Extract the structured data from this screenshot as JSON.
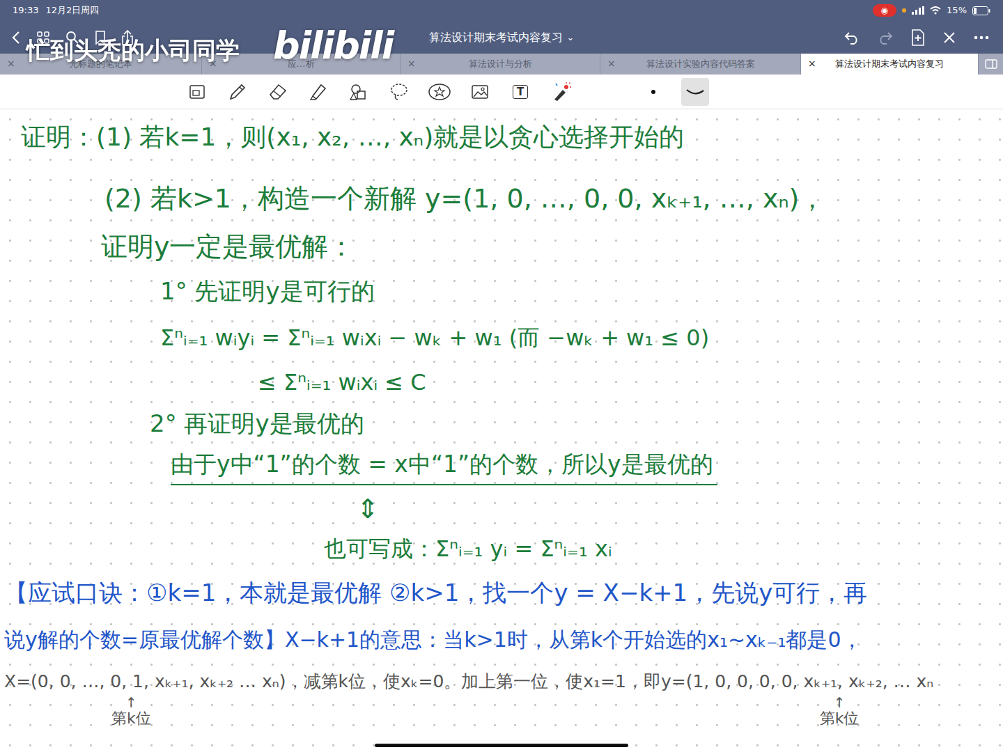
{
  "status_bar": {
    "time": "19:33",
    "date": "12月2日周四",
    "record": "◉",
    "battery": "15%"
  },
  "watermark": {
    "author": "忙到头秃的小司同学",
    "logo": "bilibili"
  },
  "toolbar": {
    "title": "算法设计期末考试内容复习",
    "dropdown": "⌄"
  },
  "tabs": [
    {
      "label": "无标题的笔记本",
      "close": "×",
      "selected": false
    },
    {
      "label": "应…析",
      "close": "×",
      "selected": false
    },
    {
      "label": "算法设计与分析",
      "close": "×",
      "selected": false
    },
    {
      "label": "算法设计实验内容代码答案",
      "close": "×",
      "selected": false
    },
    {
      "label": "算法设计期末考试内容复习",
      "close": "×",
      "selected": true
    }
  ],
  "tools": [
    {
      "selected": false
    },
    {
      "selected": false
    },
    {
      "selected": false
    },
    {
      "selected": false
    },
    {
      "selected": false
    },
    {
      "selected": false
    },
    {
      "selected": false
    },
    {
      "selected": false
    },
    {
      "selected": false,
      "label": "T"
    },
    {
      "selected": false
    },
    {
      "selected": false
    },
    {
      "selected": true
    }
  ],
  "notes": [
    {
      "text": "证明：(1) 若k=1，则(x₁, x₂, …, xₙ)就是以贪心选择开始的",
      "color": "#1b7d3a"
    },
    {
      "text": "(2) 若k>1，构造一个新解 y=(1, 0, …, 0, 0, xₖ₊₁, …, xₙ)，",
      "color": "#1b7d3a"
    },
    {
      "text": "证明y一定是最优解：",
      "color": "#1b7d3a"
    },
    {
      "text": "1° 先证明y是可行的",
      "color": "#1b7d3a"
    },
    {
      "text": "Σⁿᵢ₌₁ wᵢyᵢ = Σⁿᵢ₌₁ wᵢxᵢ − wₖ + w₁   (而 −wₖ + w₁ ≤ 0)",
      "color": "#1b7d3a"
    },
    {
      "text": "≤ Σⁿᵢ₌₁ wᵢxᵢ ≤ C",
      "color": "#1b7d3a"
    },
    {
      "text": "2° 再证明y是最优的",
      "color": "#1b7d3a"
    },
    {
      "text": "由于y中“1”的个数 = x中“1”的个数，所以y是最优的",
      "color": "#1b7d3a"
    },
    {
      "text": "⇕",
      "color": "#1b7d3a"
    },
    {
      "text": "也可写成：Σⁿᵢ₌₁ yᵢ = Σⁿᵢ₌₁ xᵢ",
      "color": "#1b7d3a"
    },
    {
      "text": "【应试口诀：①k=1，本就是最优解 ②k>1，找一个y = X−k+1，先说y可行，再",
      "color": "#1f56c9"
    },
    {
      "text": "说y解的个数=原最优解个数】X−k+1的意思：当k>1时，从第k个开始选的x₁~xₖ₋₁都是0，",
      "color": "#1f56c9"
    },
    {
      "text": "X=(0, 0, …, 0, 1, xₖ₊₁, xₖ₊₂ … xₙ)，减第k位，使xₖ=0。加上第一位，使x₁=1，即y=(1, 0, 0, 0, 0, xₖ₊₁, xₖ₊₂, … xₙ",
      "color": "#555555"
    }
  ],
  "annotations": [
    {
      "arrow": "↑",
      "label": "第k位"
    },
    {
      "arrow": "↑",
      "label": "第k位"
    }
  ]
}
